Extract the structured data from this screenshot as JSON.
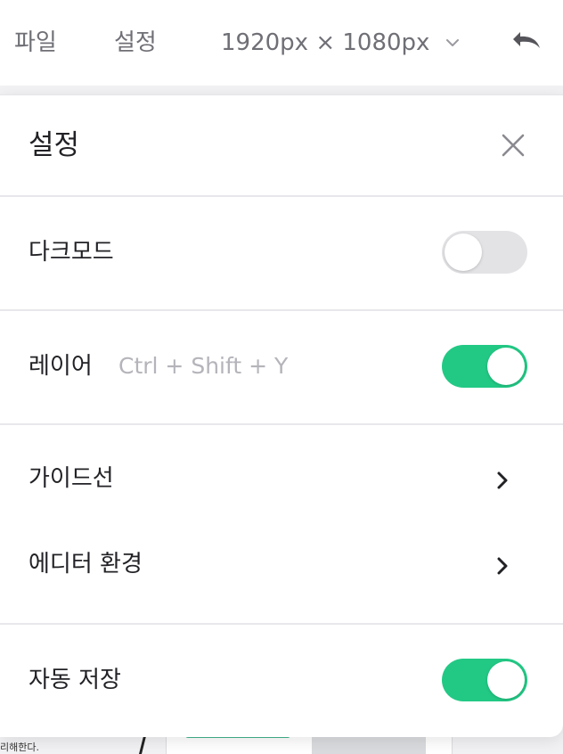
{
  "toolbar": {
    "file_label": "파일",
    "settings_label": "설정",
    "canvas_size": "1920px × 1080px",
    "undo_icon": "undo-icon",
    "size_dropdown_icon": "chevron-down-icon"
  },
  "background_preview": {
    "left_text": "리해한다."
  },
  "settings_panel": {
    "title": "설정",
    "close_icon": "close-icon",
    "rows": {
      "dark_mode": {
        "label": "다크모드",
        "enabled": false
      },
      "layer": {
        "label": "레이어",
        "shortcut": "Ctrl + Shift + Y",
        "enabled": true
      },
      "guides": {
        "label": "가이드선",
        "icon": "chevron-right-icon"
      },
      "editor_env": {
        "label": "에디터 환경",
        "icon": "chevron-right-icon"
      },
      "auto_save": {
        "label": "자동 저장",
        "enabled": true
      }
    }
  },
  "colors": {
    "toggle_on": "#22c985",
    "toggle_off": "#e3e3e6",
    "text_primary": "#222226",
    "text_muted": "#b4b4ba"
  }
}
